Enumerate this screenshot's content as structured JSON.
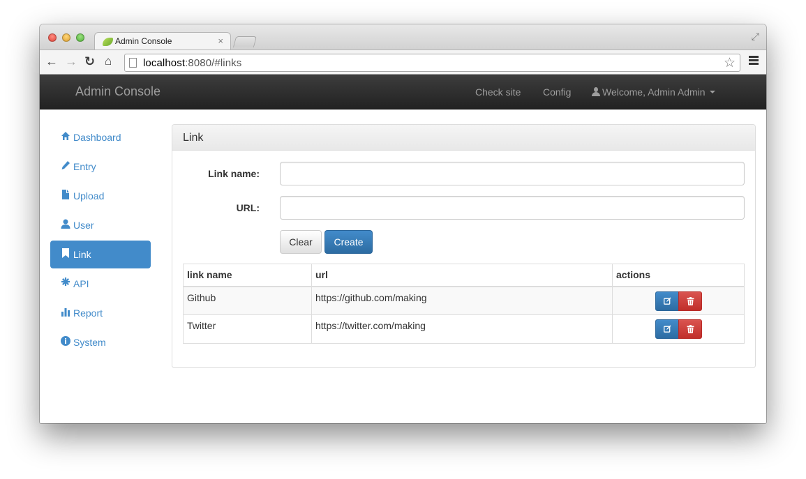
{
  "browser": {
    "tab_title": "Admin Console",
    "tab_close": "×",
    "url_host": "localhost",
    "url_rest": ":8080/#links"
  },
  "navbar": {
    "brand": "Admin Console",
    "links": {
      "check_site": "Check site",
      "config": "Config",
      "user": "Welcome, Admin Admin"
    }
  },
  "sidebar": {
    "items": [
      {
        "label": "Dashboard",
        "icon": "home-icon",
        "active": false
      },
      {
        "label": "Entry",
        "icon": "pencil-icon",
        "active": false
      },
      {
        "label": "Upload",
        "icon": "file-icon",
        "active": false
      },
      {
        "label": "User",
        "icon": "user-icon",
        "active": false
      },
      {
        "label": "Link",
        "icon": "bookmark-icon",
        "active": true
      },
      {
        "label": "API",
        "icon": "asterisk-icon",
        "active": false
      },
      {
        "label": "Report",
        "icon": "stats-icon",
        "active": false
      },
      {
        "label": "System",
        "icon": "info-icon",
        "active": false
      }
    ]
  },
  "panel": {
    "title": "Link",
    "form": {
      "name_label": "Link name:",
      "name_value": "",
      "url_label": "URL:",
      "url_value": "",
      "clear_button": "Clear",
      "create_button": "Create"
    },
    "table": {
      "headers": [
        "link name",
        "url",
        "actions"
      ],
      "rows": [
        {
          "name": "Github",
          "url": "https://github.com/making"
        },
        {
          "name": "Twitter",
          "url": "https://twitter.com/making"
        }
      ]
    }
  },
  "colors": {
    "primary": "#428bca",
    "danger": "#d9534f",
    "navbar": "#222222"
  }
}
